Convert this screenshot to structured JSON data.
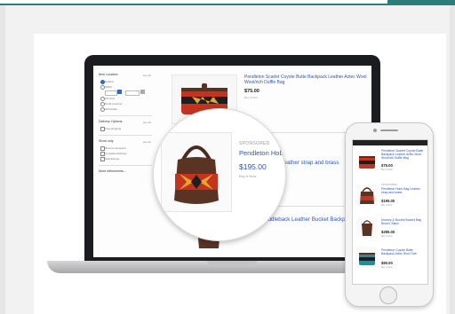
{
  "sidebar": {
    "item_location": "Item Location",
    "see_all_1": "see all",
    "location_options": [
      "Default",
      "Within",
      "US Only",
      "North America",
      "Worldwide"
    ],
    "delivery_options": "Delivery Options",
    "see_all_2": "see all",
    "free_shipping": "Free shipping",
    "show_only": "Show only",
    "see_all_3": "see all",
    "show_only_options": [
      "Returns accepted",
      "Completed listings",
      "Sold listings"
    ],
    "more_refinements": "More refinements..."
  },
  "listings": [
    {
      "title": "Pendleton Scarlet Coyote Butte Backpack Leather Aztec Wool Wool/rich Duffle Bag",
      "price": "$75.00",
      "sub": "Buy It Now"
    },
    {
      "title": "leather strap and brass",
      "price": "",
      "sub": ""
    },
    {
      "title": "Saddleback Leather Bucket Backpack, Chestnut",
      "price": "",
      "sub": ""
    }
  ],
  "magnifier": {
    "label": "SPONSORED",
    "title": "Pendleton Hobo B",
    "price": "$195.00",
    "sub": "Buy It Now"
  },
  "phone": {
    "items": [
      {
        "title": "Pendleton Scarlet Coyote Butte Backpack Leather Aztec Wool Wool/rich Duffle Bag",
        "price": "$75.00",
        "sub": "Buy It Now",
        "label": ""
      },
      {
        "title": "Pendleton Hobo Bag Leather strap and brass",
        "price": "$195.00",
        "sub": "Buy It Now",
        "label": "SPONSORED"
      },
      {
        "title": "Dooney & Bourke Bucket Bag Brown, Black",
        "price": "$285.00",
        "sub": "Buy It Now",
        "label": ""
      },
      {
        "title": "Pendleton Coyote Butte Backpack Aztec Wool Tote",
        "price": "$90.00",
        "sub": "Buy It Now",
        "label": ""
      }
    ]
  },
  "colors": {
    "accent": "#2d7d78",
    "link": "#2a55c8",
    "bag_red": "#c43220",
    "bag_brown": "#4a2a1e"
  }
}
